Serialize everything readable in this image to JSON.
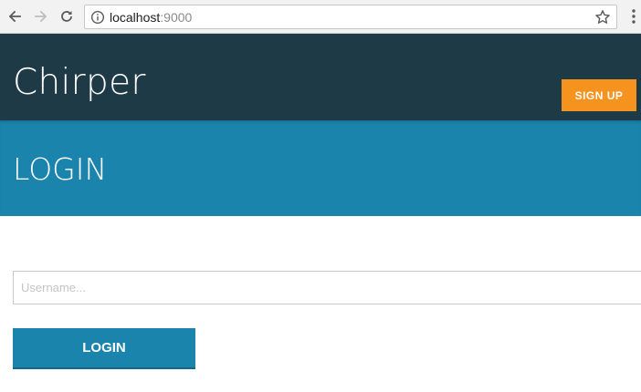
{
  "browser": {
    "url_host": "localhost",
    "url_port": ":9000",
    "icons": [
      "back-arrow-icon",
      "forward-arrow-icon",
      "reload-icon",
      "info-icon",
      "star-icon",
      "kebab-menu-icon"
    ]
  },
  "header": {
    "brand": "Chirper",
    "signup_label": "SIGN UP"
  },
  "banner": {
    "title": "LOGIN"
  },
  "form": {
    "username_placeholder": "Username...",
    "username_value": "",
    "login_label": "LOGIN"
  },
  "colors": {
    "header_bg": "#1e3a47",
    "banner_bg": "#1a84ad",
    "signup_bg": "#f6921e",
    "login_bg": "#1a84ad"
  }
}
